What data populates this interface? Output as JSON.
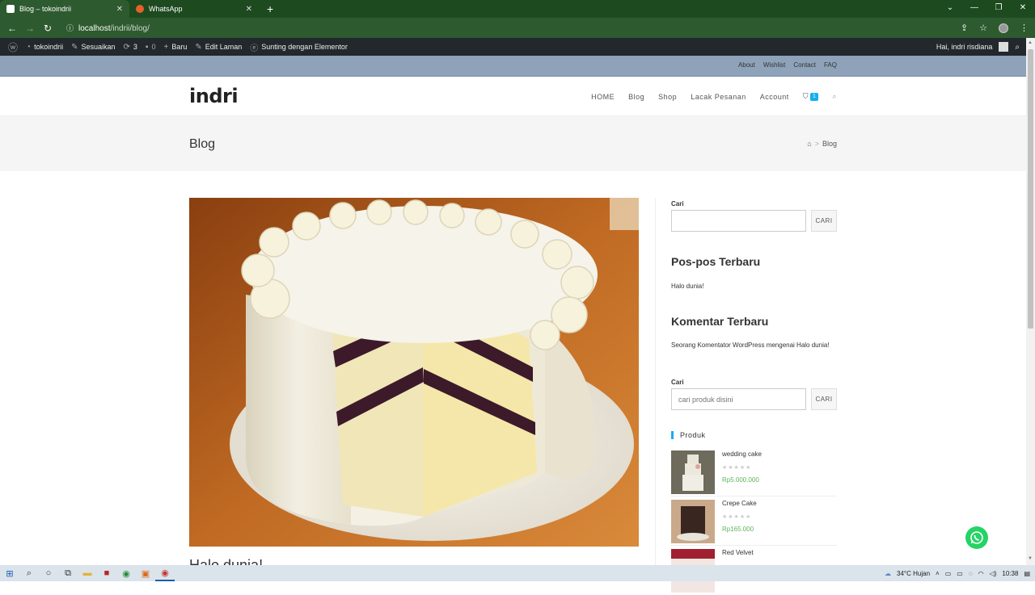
{
  "browser": {
    "tabs": [
      {
        "title": "Blog – tokoindrii",
        "active": true,
        "favicon_color": "#ffffff"
      },
      {
        "title": "WhatsApp",
        "active": false,
        "favicon_color": "#e6612a"
      }
    ],
    "url_host": "localhost",
    "url_path": "/indrii/blog/"
  },
  "adminbar": {
    "site": "tokoindrii",
    "customize": "Sesuaikan",
    "updates": "3",
    "comments": "0",
    "new": "Baru",
    "edit": "Edit Laman",
    "elementor": "Sunting dengan Elementor",
    "greeting": "Hai, indri risdiana"
  },
  "topmenu": [
    "About",
    "Wishlist",
    "Contact",
    "FAQ"
  ],
  "logo": "indri",
  "nav": [
    "HOME",
    "Blog",
    "Shop",
    "Lacak Pesanan",
    "Account"
  ],
  "cart_count": "1",
  "page": {
    "title": "Blog",
    "breadcrumb_sep": ">",
    "breadcrumb_current": "Blog"
  },
  "post": {
    "title": "Halo dunia!"
  },
  "sidebar": {
    "search1": {
      "label": "Cari",
      "value": "",
      "button": "CARI"
    },
    "recent_posts": {
      "title": "Pos-pos Terbaru",
      "items": [
        "Halo dunia!"
      ]
    },
    "recent_comments": {
      "title": "Komentar Terbaru",
      "text": "Seorang Komentator WordPress mengenai Halo dunia!"
    },
    "search2": {
      "label": "Cari",
      "placeholder": "cari produk disini",
      "button": "CARI"
    },
    "products": {
      "title": "Produk",
      "items": [
        {
          "name": "wedding cake",
          "price": "Rp5.000.000",
          "rating": 0
        },
        {
          "name": "Crepe Cake",
          "price": "Rp165.000",
          "rating": 0
        },
        {
          "name": "Red Velvet",
          "price": "",
          "rating": 0
        }
      ]
    }
  },
  "taskbar": {
    "weather": "34°C  Hujan",
    "time": "10:38"
  },
  "colors": {
    "accent": "#13aff0",
    "price": "#5bb75b",
    "topbar": "#8ea2b9",
    "chrome": "#2d5a2e"
  }
}
